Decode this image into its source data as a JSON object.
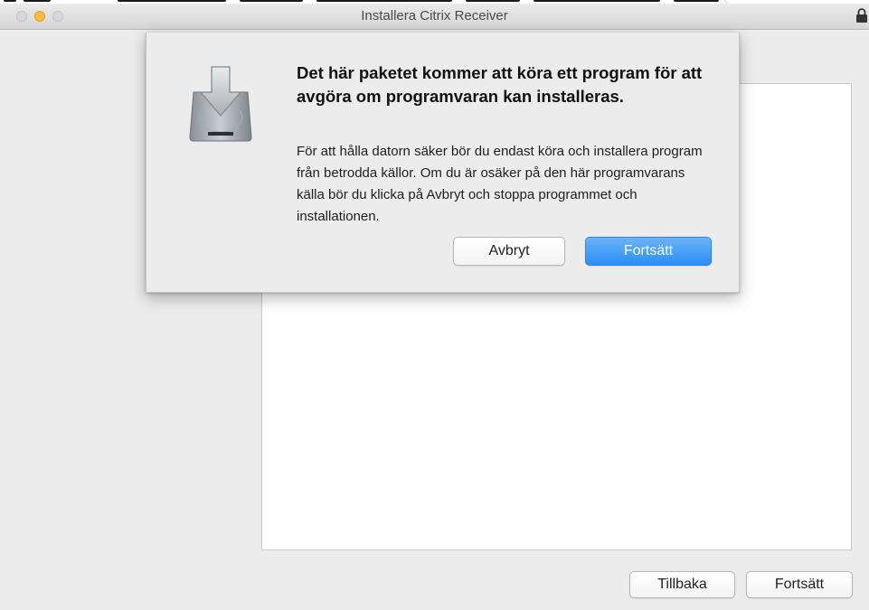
{
  "window": {
    "title": "Installera Citrix Receiver",
    "traffic_lights": [
      "close",
      "minimize",
      "zoom"
    ]
  },
  "alert": {
    "icon": "installer-package-icon",
    "title": "Det här paketet kommer att köra ett program för att avgöra om programvaran kan installeras.",
    "message": "För att hålla datorn säker bör du endast köra och installera program från betrodda källor. Om du är osäker på den här programvarans källa bör du klicka på Avbryt och stoppa programmet och installationen.",
    "cancel_label": "Avbryt",
    "continue_label": "Fortsätt"
  },
  "footer": {
    "back_label": "Tillbaka",
    "continue_label": "Fortsätt"
  },
  "colors": {
    "primary_button": "#2a8ef5",
    "minimize_light": "#fdbc40",
    "window_bg": "#ececec"
  },
  "icons": [
    "lock-icon",
    "installer-package-icon"
  ]
}
